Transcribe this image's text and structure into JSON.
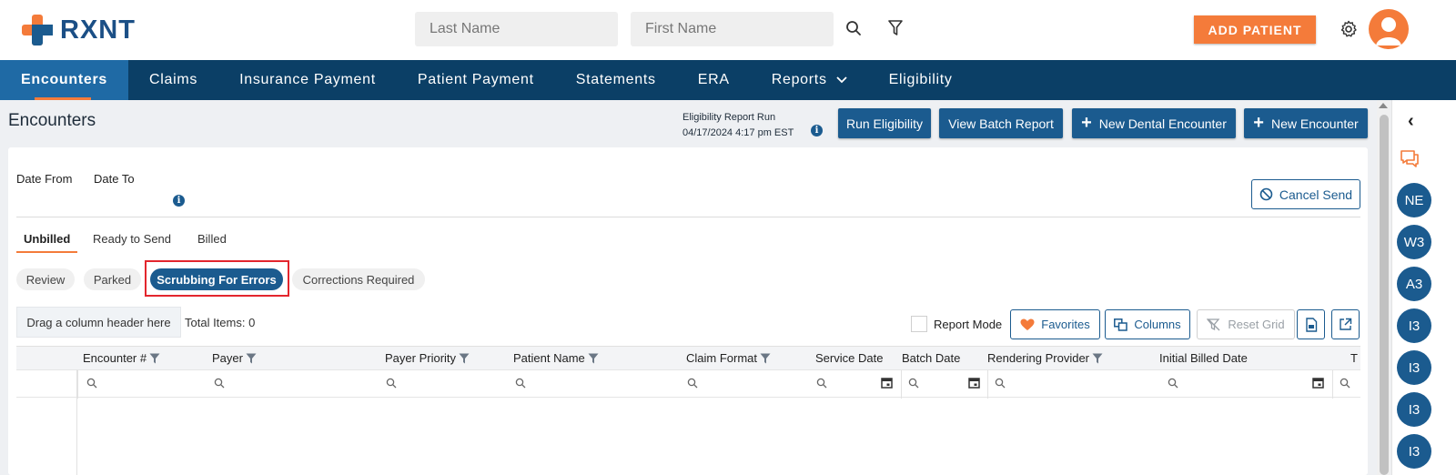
{
  "brand": {
    "logo_text": "RXNT",
    "orange": "#f47b3a",
    "blue": "#1b5b8f",
    "navy": "#0b3f66"
  },
  "header": {
    "last_name_placeholder": "Last Name",
    "first_name_placeholder": "First Name",
    "search_icon": "search-icon",
    "filter_icon": "filter-icon",
    "add_patient_label": "ADD PATIENT",
    "settings_icon": "gear-icon"
  },
  "nav": {
    "items": [
      {
        "label": "Encounters",
        "active": true
      },
      {
        "label": "Claims"
      },
      {
        "label": "Insurance Payment"
      },
      {
        "label": "Patient Payment"
      },
      {
        "label": "Statements"
      },
      {
        "label": "ERA"
      },
      {
        "label": "Reports"
      },
      {
        "label": "Eligibility"
      }
    ]
  },
  "page": {
    "title": "Encounters",
    "eligibility_run_label": "Eligibility Report Run",
    "eligibility_run_time": "04/17/2024 4:17 pm EST",
    "info_glyph": "i",
    "buttons": {
      "run_eligibility": "Run Eligibility",
      "view_batch_report": "View Batch Report",
      "new_dental_encounter": "New Dental Encounter",
      "new_encounter": "New Encounter",
      "plus_glyph": "+"
    }
  },
  "filters": {
    "date_from": "Date From",
    "date_to": "Date To",
    "cancel_send": "Cancel Send"
  },
  "tabs": [
    {
      "label": "Unbilled",
      "active": true
    },
    {
      "label": "Ready to Send"
    },
    {
      "label": "Billed"
    }
  ],
  "subtabs": [
    {
      "label": "Review"
    },
    {
      "label": "Parked"
    },
    {
      "label": "Scrubbing For Errors",
      "active": true
    },
    {
      "label": "Corrections Required"
    }
  ],
  "grid": {
    "drag_hint": "Drag a column header here",
    "total_items": "Total Items: 0",
    "report_mode": "Report Mode",
    "favorites": "Favorites",
    "columns_btn": "Columns",
    "reset_grid": "Reset Grid",
    "columns": [
      {
        "label": "Encounter #",
        "filter": true
      },
      {
        "label": "Payer",
        "filter": true
      },
      {
        "label": "Payer Priority",
        "filter": true
      },
      {
        "label": "Patient Name",
        "filter": true
      },
      {
        "label": "Claim Format",
        "filter": true
      },
      {
        "label": "Service Date",
        "filter": false
      },
      {
        "label": "Batch Date",
        "filter": false
      },
      {
        "label": "Rendering Provider",
        "filter": true
      },
      {
        "label": "Initial Billed Date",
        "filter": false
      },
      {
        "label": "T",
        "filter": false
      }
    ]
  },
  "rail": {
    "collapse_glyph": "‹",
    "bubbles": [
      "NE",
      "W3",
      "A3",
      "I3",
      "I3",
      "I3",
      "I3"
    ]
  }
}
